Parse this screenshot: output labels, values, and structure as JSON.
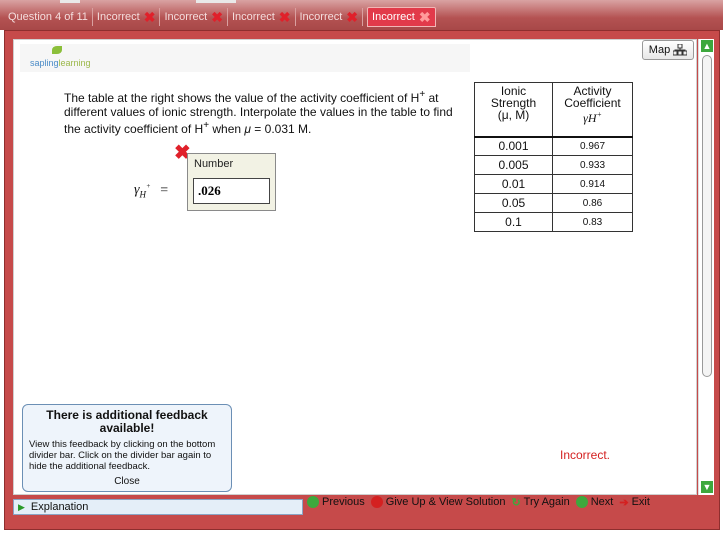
{
  "tabs": [
    {
      "label": "Question 4 of 11"
    },
    {
      "label": "Incorrect",
      "icon": "red-x-icon"
    },
    {
      "label": "Incorrect",
      "icon": "red-x-icon"
    },
    {
      "label": "Incorrect",
      "icon": "red-x-icon"
    },
    {
      "label": "Incorrect",
      "icon": "red-x-icon"
    },
    {
      "label": "Incorrect",
      "icon": "red-x-icon",
      "active": true
    }
  ],
  "logo": {
    "part1": "sapling",
    "part2": "learning"
  },
  "map_label": "Map",
  "question": {
    "line1": "The table at the right shows the value of the activity coefficient of H",
    "sup1": "+",
    "line1_end": " at different values of ionic strength.  Interpolate the values in the table to find the activity coefficient of H",
    "sup2": "+",
    "line1_tail": " when ",
    "mu": "μ",
    "value_text": " = 0.031 M."
  },
  "answer": {
    "label": "Number",
    "value": ".026",
    "gamma_symbol": "γ",
    "gamma_sub": "H",
    "gamma_sup": "+",
    "equals": "="
  },
  "table": {
    "header_col1": [
      "Ionic",
      "Strength",
      "(μ, M)"
    ],
    "header_col2": [
      "Activity",
      "Coefficient",
      "γH"
    ],
    "rows": [
      [
        "0.001",
        "0.967"
      ],
      [
        "0.005",
        "0.933"
      ],
      [
        "0.01",
        "0.914"
      ],
      [
        "0.05",
        "0.86"
      ],
      [
        "0.1",
        "0.83"
      ]
    ]
  },
  "feedback": {
    "title": "There is additional feedback available!",
    "body": "View this feedback by clicking on the bottom divider bar. Click on the divider bar again to hide the additional feedback.",
    "close": "Close"
  },
  "status": "Incorrect.",
  "nav": {
    "previous": "Previous",
    "give_up": "Give Up & View Solution",
    "try_again": "Try Again",
    "next": "Next",
    "exit": "Exit"
  },
  "explanation": "Explanation",
  "colors": {
    "accent_red": "#c64a4a",
    "incorrect": "#d42020",
    "nav_green": "#3da83d"
  }
}
